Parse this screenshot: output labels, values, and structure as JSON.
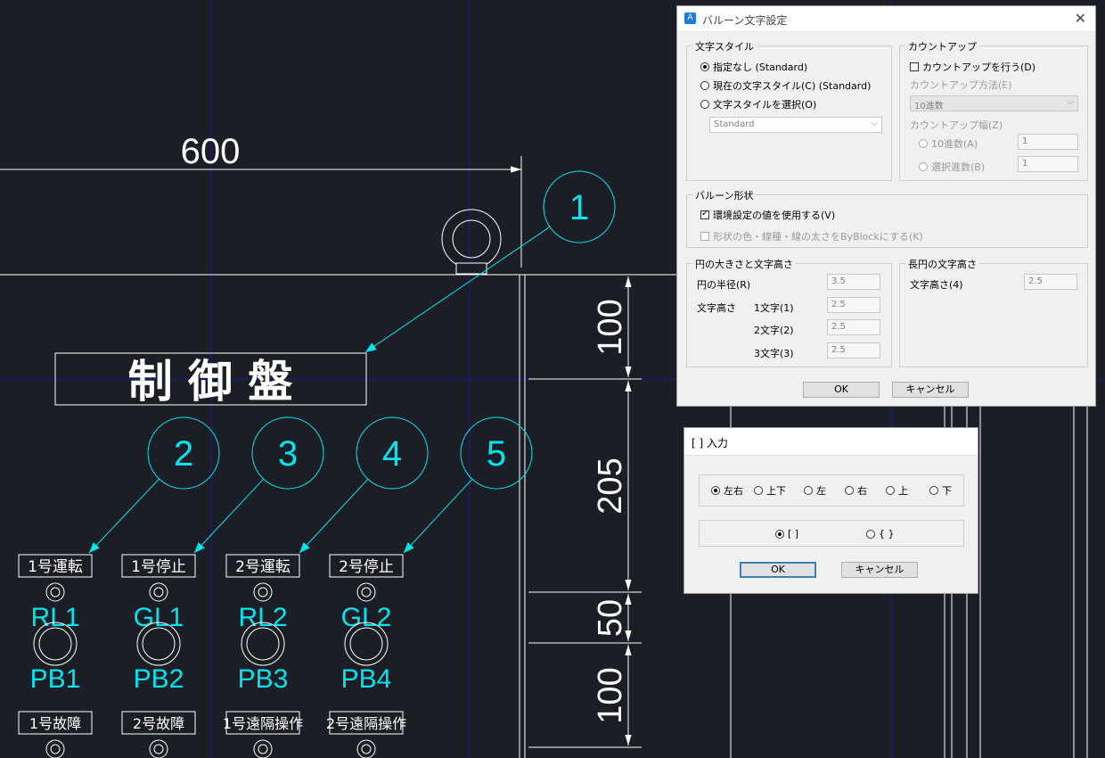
{
  "canvas": {
    "dimensions": [
      {
        "value": "600",
        "orient": "h"
      },
      {
        "value": "100",
        "orient": "v"
      },
      {
        "value": "205",
        "orient": "v"
      },
      {
        "value": "50",
        "orient": "v"
      },
      {
        "value": "100",
        "orient": "v"
      }
    ],
    "panel_title": "制 御 盤",
    "balloons": [
      "1",
      "2",
      "3",
      "4",
      "5"
    ],
    "label_row1": [
      "1号運転",
      "1号停止",
      "2号運転",
      "2号停止"
    ],
    "lamp_labels": [
      "RL1",
      "GL1",
      "RL2",
      "GL2"
    ],
    "button_labels": [
      "PB1",
      "PB2",
      "PB3",
      "PB4"
    ],
    "label_row2": [
      "1号故障",
      "2号故障",
      "1号遠隔操作",
      "2号遠隔操作"
    ],
    "colors": {
      "background": "#1b1f25",
      "cyan": "#00e5f0",
      "white": "#ffffff",
      "grid": "#1a1aa0"
    }
  },
  "balloon_dialog": {
    "title": "バルーン文字設定",
    "text_style": {
      "label": "文字スタイル",
      "opt_none": "指定なし (Standard)",
      "opt_current": "現在の文字スタイル(C) (Standard)",
      "opt_select": "文字スタイルを選択(O)",
      "style_value": "Standard"
    },
    "count_up": {
      "label": "カウントアップ",
      "check": "カウントアップを行う(D)",
      "method_label": "カウントアップ方法(E)",
      "method_value": "10進数",
      "width_label": "カウントアップ幅(Z)",
      "decimal_label": "10進数(A)",
      "decimal_value": "1",
      "select_label": "選択進数(B)",
      "select_value": "1"
    },
    "shape": {
      "label": "バルーン形状",
      "use_env": "環境設定の値を使用する(V)",
      "byblock": "形状の色・線種・線の太さをByBlockにする(K)"
    },
    "circle": {
      "label": "円の大きさと文字高さ",
      "radius_label": "円の半径(R)",
      "radius_value": "3.5",
      "text_height": "文字高さ",
      "c1_label": "1文字(1)",
      "c1_value": "2.5",
      "c2_label": "2文字(2)",
      "c2_value": "2.5",
      "c3_label": "3文字(3)",
      "c3_value": "2.5"
    },
    "ellipse": {
      "label": "長円の文字高さ",
      "height_label": "文字高さ(4)",
      "height_value": "2.5"
    },
    "ok": "OK",
    "cancel": "キャンセル"
  },
  "bracket_dialog": {
    "title": "[ ] 入力",
    "positions": [
      "左右",
      "上下",
      "左",
      "右",
      "上",
      "下"
    ],
    "brackets": [
      "[ ]",
      "{ }"
    ],
    "ok": "OK",
    "cancel": "キャンセル"
  }
}
